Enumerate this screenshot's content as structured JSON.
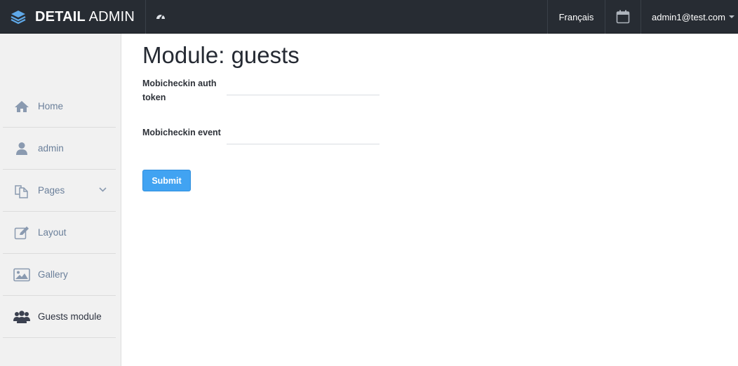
{
  "header": {
    "brand_bold": "DETAIL",
    "brand_light": " ADMIN",
    "language": "Français",
    "user_email": "admin1@test.com"
  },
  "sidebar": {
    "items": [
      {
        "label": "Home",
        "icon": "home-icon"
      },
      {
        "label": "admin",
        "icon": "user-icon"
      },
      {
        "label": "Pages",
        "icon": "pages-icon",
        "has_submenu": true
      },
      {
        "label": "Layout",
        "icon": "edit-icon"
      },
      {
        "label": "Gallery",
        "icon": "image-icon"
      },
      {
        "label": "Guests module",
        "icon": "users-icon",
        "active": true
      }
    ]
  },
  "main": {
    "title": "Module: guests",
    "fields": [
      {
        "label": "Mobicheckin auth token",
        "value": ""
      },
      {
        "label": "Mobicheckin event",
        "value": ""
      }
    ],
    "submit_label": "Submit"
  },
  "colors": {
    "topbar": "#272c33",
    "sidebar": "#f1f1f1",
    "accent": "#41a3f2",
    "brand_icon": "#5fa8e8"
  }
}
